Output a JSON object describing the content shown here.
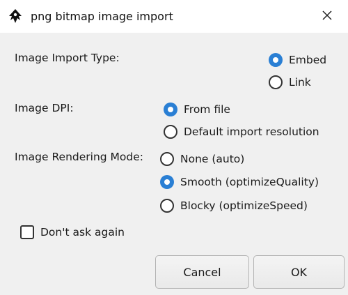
{
  "window": {
    "title": "png bitmap image import",
    "app_icon": "inkscape-logo-icon",
    "close_icon": "close-icon"
  },
  "import_type": {
    "label": "Image Import Type:",
    "options": [
      {
        "label": "Embed",
        "selected": true
      },
      {
        "label": "Link",
        "selected": false
      }
    ]
  },
  "dpi": {
    "label": "Image DPI:",
    "options": [
      {
        "label": "From file",
        "selected": true
      },
      {
        "label": "Default import resolution",
        "selected": false
      }
    ]
  },
  "rendering": {
    "label": "Image Rendering Mode:",
    "options": [
      {
        "label": "None (auto)",
        "selected": false
      },
      {
        "label": "Smooth (optimizeQuality)",
        "selected": true
      },
      {
        "label": "Blocky (optimizeSpeed)",
        "selected": false
      }
    ]
  },
  "dont_ask": {
    "label": "Don't ask again",
    "checked": false
  },
  "buttons": {
    "cancel": "Cancel",
    "ok": "OK"
  },
  "colors": {
    "accent": "#2a7fd4",
    "background": "#f0f0f0"
  }
}
